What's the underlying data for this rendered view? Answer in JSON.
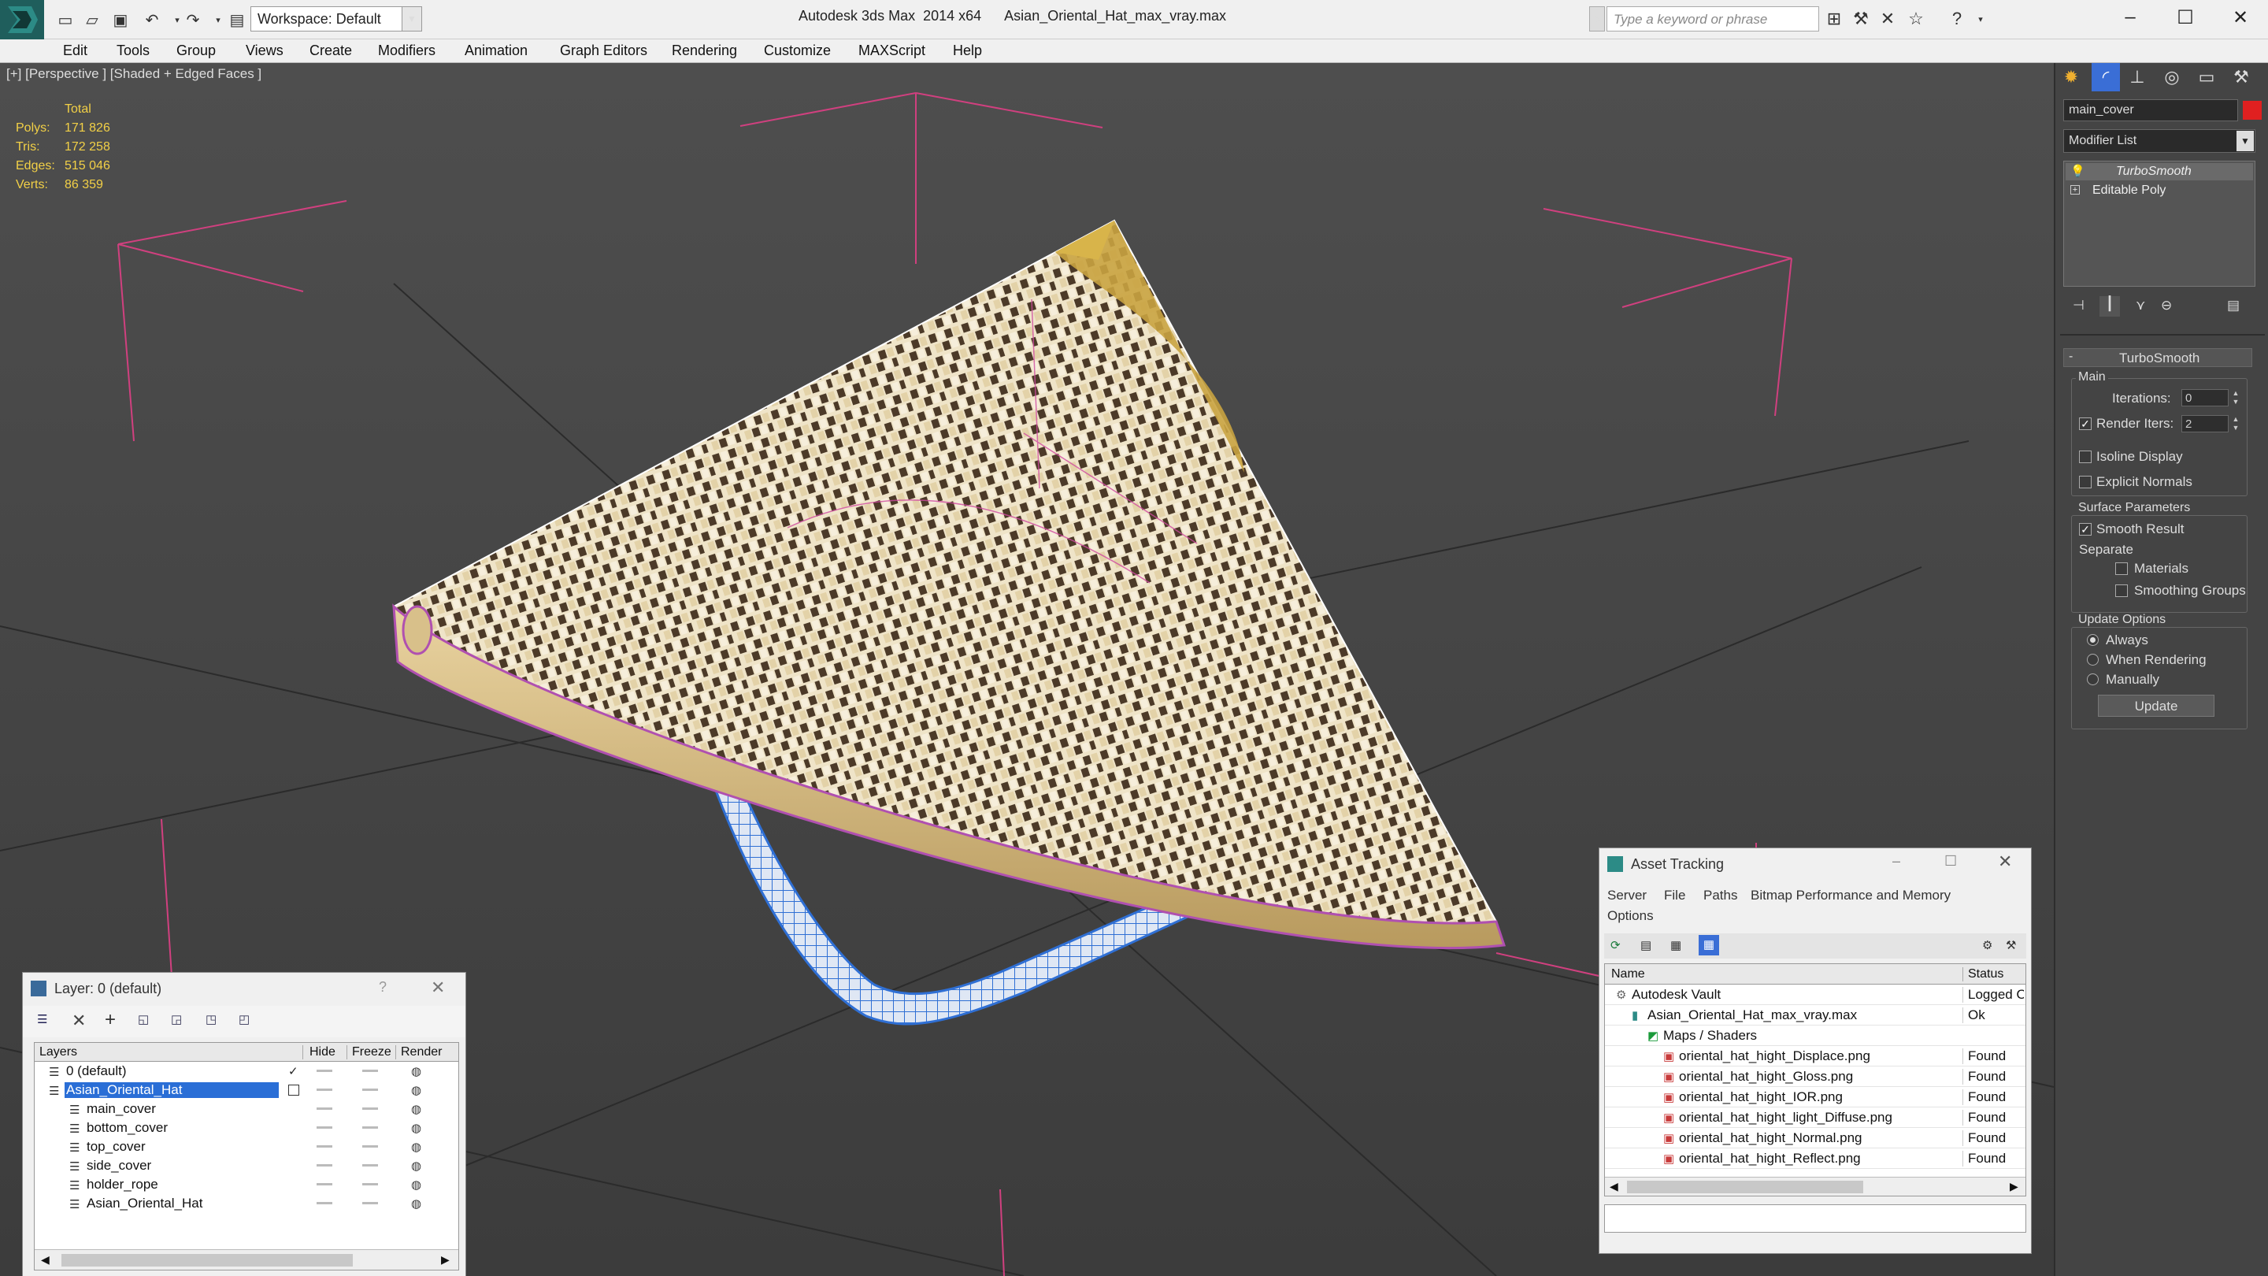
{
  "app": {
    "title": "Autodesk 3ds Max  2014 x64",
    "file": "Asian_Oriental_Hat_max_vray.max",
    "workspace": "Workspace: Default",
    "search_placeholder": "Type a keyword or phrase"
  },
  "menu": [
    "Edit",
    "Tools",
    "Group",
    "Views",
    "Create",
    "Modifiers",
    "Animation",
    "Graph Editors",
    "Rendering",
    "Customize",
    "MAXScript",
    "Help"
  ],
  "viewport": {
    "label": "[+] [Perspective ] [Shaded + Edged Faces ]",
    "stats": {
      "header": "Total",
      "rows": [
        {
          "label": "Polys:",
          "value": "171 826"
        },
        {
          "label": "Tris:",
          "value": "172 258"
        },
        {
          "label": "Edges:",
          "value": "515 046"
        },
        {
          "label": "Verts:",
          "value": "86 359"
        }
      ]
    }
  },
  "command_panel": {
    "object_name": "main_cover",
    "object_color": "#e02020",
    "modifier_list": "Modifier List",
    "stack": [
      "TurboSmooth",
      "Editable Poly"
    ],
    "rollout_title": "TurboSmooth",
    "main_group": "Main",
    "iterations_label": "Iterations:",
    "iterations_value": "0",
    "render_iters_label": "Render Iters:",
    "render_iters_value": "2",
    "render_iters_checked": true,
    "isoline_label": "Isoline Display",
    "explicit_normals_label": "Explicit Normals",
    "surface_group": "Surface Parameters",
    "smooth_result_label": "Smooth Result",
    "separate_label": "Separate",
    "materials_label": "Materials",
    "smoothing_groups_label": "Smoothing Groups",
    "update_group": "Update Options",
    "update_options": [
      "Always",
      "When Rendering",
      "Manually"
    ],
    "update_selected": "Always",
    "update_button": "Update"
  },
  "layer_window": {
    "title": "Layer: 0 (default)",
    "help": "?",
    "columns": [
      "Layers",
      "Hide",
      "Freeze",
      "Render"
    ],
    "rows": [
      {
        "name": "0 (default)",
        "indent": 1,
        "selected": false
      },
      {
        "name": "Asian_Oriental_Hat",
        "indent": 1,
        "selected": true
      },
      {
        "name": "main_cover",
        "indent": 2,
        "selected": false
      },
      {
        "name": "bottom_cover",
        "indent": 2,
        "selected": false
      },
      {
        "name": "top_cover",
        "indent": 2,
        "selected": false
      },
      {
        "name": "side_cover",
        "indent": 2,
        "selected": false
      },
      {
        "name": "holder_rope",
        "indent": 2,
        "selected": false
      },
      {
        "name": "Asian_Oriental_Hat",
        "indent": 2,
        "selected": false
      }
    ]
  },
  "asset_window": {
    "title": "Asset Tracking",
    "menu": [
      "Server",
      "File",
      "Paths",
      "Bitmap Performance and Memory",
      "Options"
    ],
    "columns": [
      "Name",
      "Status"
    ],
    "rows": [
      {
        "name": "Autodesk Vault",
        "status": "Logged O",
        "level": 0,
        "icon": "vault-icon"
      },
      {
        "name": "Asian_Oriental_Hat_max_vray.max",
        "status": "Ok",
        "level": 1,
        "icon": "max-file-icon"
      },
      {
        "name": "Maps / Shaders",
        "status": "",
        "level": 2,
        "icon": "maps-folder-icon"
      },
      {
        "name": "oriental_hat_hight_Displace.png",
        "status": "Found",
        "level": 3,
        "icon": "png-icon"
      },
      {
        "name": "oriental_hat_hight_Gloss.png",
        "status": "Found",
        "level": 3,
        "icon": "png-icon"
      },
      {
        "name": "oriental_hat_hight_IOR.png",
        "status": "Found",
        "level": 3,
        "icon": "png-icon"
      },
      {
        "name": "oriental_hat_hight_light_Diffuse.png",
        "status": "Found",
        "level": 3,
        "icon": "png-icon"
      },
      {
        "name": "oriental_hat_hight_Normal.png",
        "status": "Found",
        "level": 3,
        "icon": "png-icon"
      },
      {
        "name": "oriental_hat_hight_Reflect.png",
        "status": "Found",
        "level": 3,
        "icon": "png-icon"
      }
    ]
  },
  "colors": {
    "stat_yellow": "#f2d046",
    "selection_blue": "#2a6ed6",
    "wire_magenta": "#d04aa0",
    "rope_blue": "#3a78d8"
  }
}
